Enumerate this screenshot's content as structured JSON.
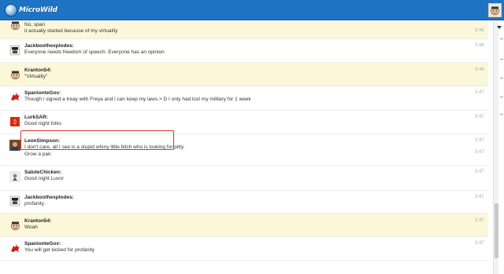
{
  "header": {
    "logo_text": "MicroWild"
  },
  "messages": [
    {
      "user": "",
      "message": "No, span",
      "time": "",
      "highlight": true,
      "avatar": "face-avatar"
    },
    {
      "user": "",
      "message": "it actually started because of my virtuality",
      "time": "3:46",
      "highlight": true,
      "avatar": ""
    },
    {
      "user": "Jackboothexplodes:",
      "message": "Everyone needs freedom of speech. Everyone has an opinion",
      "time": "3:46",
      "highlight": false,
      "avatar": "soldier-avatar"
    },
    {
      "user": "Kranton54:",
      "message": "\"Virtuality\"",
      "time": "3:46",
      "highlight": true,
      "avatar": "face-avatar"
    },
    {
      "user": "SpanionteGov:",
      "message": "Though i signed a treay with Freya and i can keep my laws > D I only had lost my military for 1 week",
      "time": "3:47",
      "highlight": false,
      "avatar": "red-dragon-avatar"
    },
    {
      "user": "LurkSAR:",
      "message": "Good night folks",
      "time": "3:47",
      "highlight": false,
      "avatar": "flag-avatar"
    },
    {
      "user": "LeonSimpson:",
      "message": "I don't care, all I see is a stupid whiny little bitch who is looking for pitty.",
      "message2": "Grow a pair.",
      "time": "3:47",
      "time2": "3:47",
      "highlight": false,
      "avatar": "photo-avatar"
    },
    {
      "user": "SaluteChicken:",
      "message": "Good night Luxor",
      "time": "3:47",
      "highlight": false,
      "avatar": "chicken-avatar"
    },
    {
      "user": "Jackboothexplodes:",
      "message": "profanity.",
      "time": "3:47",
      "highlight": false,
      "avatar": "soldier-avatar"
    },
    {
      "user": "Kranton54:",
      "message": "Woah",
      "time": "3:47",
      "highlight": true,
      "avatar": "face-avatar"
    },
    {
      "user": "SpanionteGov:",
      "message": "You will get kicked for profanity",
      "time": "3:47",
      "highlight": false,
      "avatar": "red-dragon-avatar"
    }
  ]
}
